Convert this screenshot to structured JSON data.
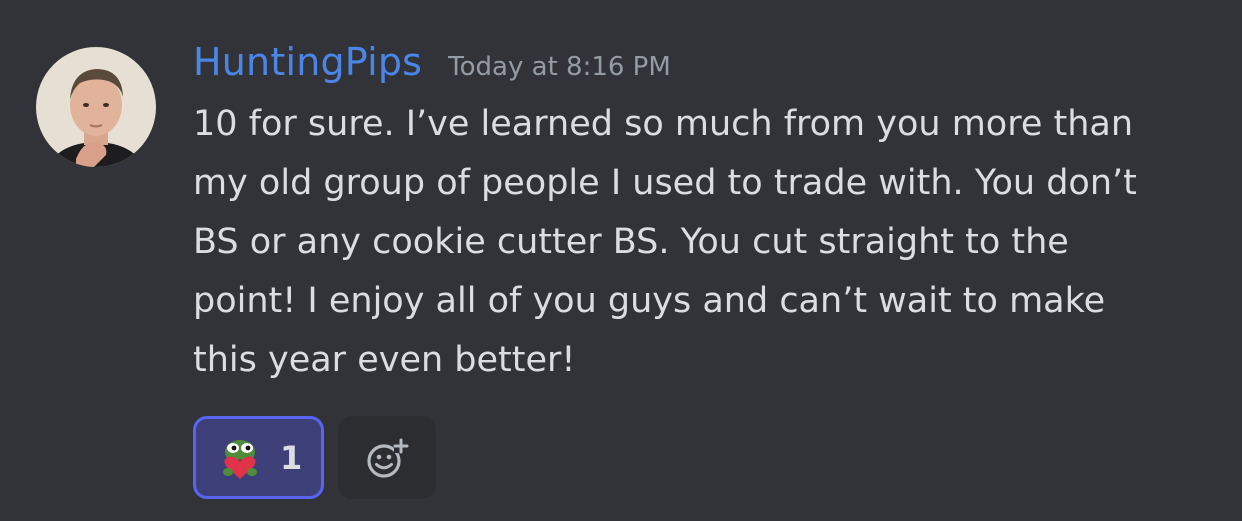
{
  "message": {
    "author": "HuntingPips",
    "timestamp": "Today at 8:16 PM",
    "lines": [
      "10 for sure. I’ve learned so much from you more than",
      "my old group of people I used to trade with. You don’t",
      "BS or any cookie cutter BS. You cut straight to the",
      "point!  I enjoy all of you guys and can’t wait to make",
      "this year even better!"
    ]
  },
  "reactions": [
    {
      "emoji": "pepe-heart-icon",
      "count": "1"
    }
  ],
  "add_reaction": {
    "icon": "add-reaction-icon"
  },
  "colors": {
    "background": "#313338",
    "username": "#4a86e8",
    "reaction_bg": "#3c3f78",
    "reaction_border": "#5865f2"
  }
}
